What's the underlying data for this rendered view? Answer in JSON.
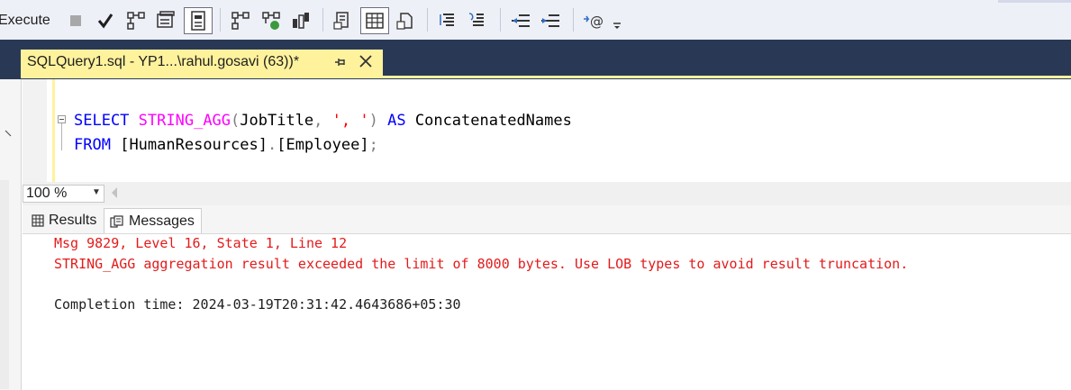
{
  "toolbar": {
    "execute_label": "Execute",
    "icons": [
      "stop-icon",
      "parse-check-icon",
      "display-plan-icon",
      "query-options-icon",
      "results-to-grid-icon",
      "live-stats-icon",
      "actual-plan-icon",
      "client-stats-icon",
      "results-to-text-icon",
      "results-to-file-icon",
      "include-plan-icon",
      "comment-icon",
      "uncomment-icon",
      "decrease-indent-icon",
      "increase-indent-icon",
      "specify-values-icon"
    ]
  },
  "tab": {
    "title": "SQLQuery1.sql - YP1...\\rahul.gosavi (63))*"
  },
  "editor": {
    "line1": {
      "kw_select": "SELECT",
      "fn": "STRING_AGG",
      "open": "(",
      "arg": "JobTitle",
      "comma": ",",
      "sep_str": "', '",
      "close": ")",
      "kw_as": "AS",
      "alias": "ConcatenatedNames"
    },
    "line2": {
      "kw_from": "FROM",
      "schema": "[HumanResources]",
      "dot": ".",
      "table": "[Employee]",
      "semi": ";"
    }
  },
  "zoom": {
    "value": "100 %"
  },
  "results_tabs": [
    {
      "label": "Results",
      "icon": "grid-icon"
    },
    {
      "label": "Messages",
      "icon": "messages-icon"
    }
  ],
  "messages": {
    "line1": "Msg 9829, Level 16, State 1, Line 12",
    "line2": "STRING_AGG aggregation result exceeded the limit of 8000 bytes. Use LOB types to avoid result truncation.",
    "completion": "Completion time: 2024-03-19T20:31:42.4643686+05:30"
  },
  "colors": {
    "keyword": "#0000ff",
    "function": "#ff00ff",
    "string": "#ff0000",
    "error": "#e31b1b",
    "tab_active": "#fff29d",
    "navy": "#293955"
  }
}
